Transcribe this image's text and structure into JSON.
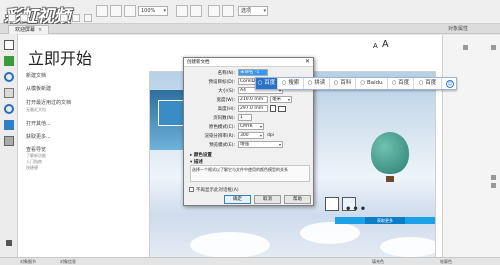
{
  "watermark": "彩虹视频",
  "toolbar": {
    "zoom": "100%",
    "select_text": "选项",
    "units_label": "单位"
  },
  "tabs": {
    "active": "欢迎屏幕",
    "right_panel_title": "对象属性"
  },
  "welcome": {
    "title": "立即开始",
    "font_small": "A",
    "font_large": "A",
    "links": [
      {
        "label": "新建文档"
      },
      {
        "label": "从模板新建"
      },
      {
        "label": "打开最近用过的文档"
      },
      {
        "label": "打开其他..."
      },
      {
        "label": "获取更多..."
      },
      {
        "label": "查看导览"
      }
    ],
    "recent_sub": [
      "无最近文档"
    ],
    "tour_sub": [
      "了解新功能",
      "入门指南",
      "快捷键"
    ],
    "banner_button": "获取更多",
    "banner_more": "•••"
  },
  "dialog": {
    "title": "创建新文档",
    "close": "✕",
    "fields": [
      {
        "label": "名称(N):",
        "value": "未命名 -1"
      },
      {
        "label": "预设目标(D):",
        "value": "CorelDRAW 默认"
      },
      {
        "label": "大小(S):",
        "value": "A4"
      },
      {
        "label": "宽度(W):",
        "value": "210.0 mm",
        "unit": "毫米"
      },
      {
        "label": "高度(H):",
        "value": "297.0 mm"
      },
      {
        "label": "页码数(N):",
        "value": "1"
      },
      {
        "label": "原色模式(C):",
        "value": "CMYK"
      },
      {
        "label": "渲染分辨率(R):",
        "value": "300",
        "unit": "dpi"
      },
      {
        "label": "预览模式(E):",
        "value": "增强"
      }
    ],
    "section_color": "颜色设置",
    "section_desc": "描述",
    "description": "选择一个格式以了解它与文件中使用的颜色模型的关系",
    "checkbox_label": "不再显示此对话框(A)",
    "btn_ok": "确定",
    "btn_cancel": "取消",
    "btn_help": "帮助"
  },
  "ime": {
    "items": [
      "百度",
      "搜索",
      "拼读",
      "百科",
      "Baidu",
      "百度",
      "百度"
    ],
    "smile": "☺"
  },
  "statusbar": {
    "left": "对象细节",
    "middle": "对象信息",
    "right1": "填充色",
    "right2": "轮廓色"
  }
}
